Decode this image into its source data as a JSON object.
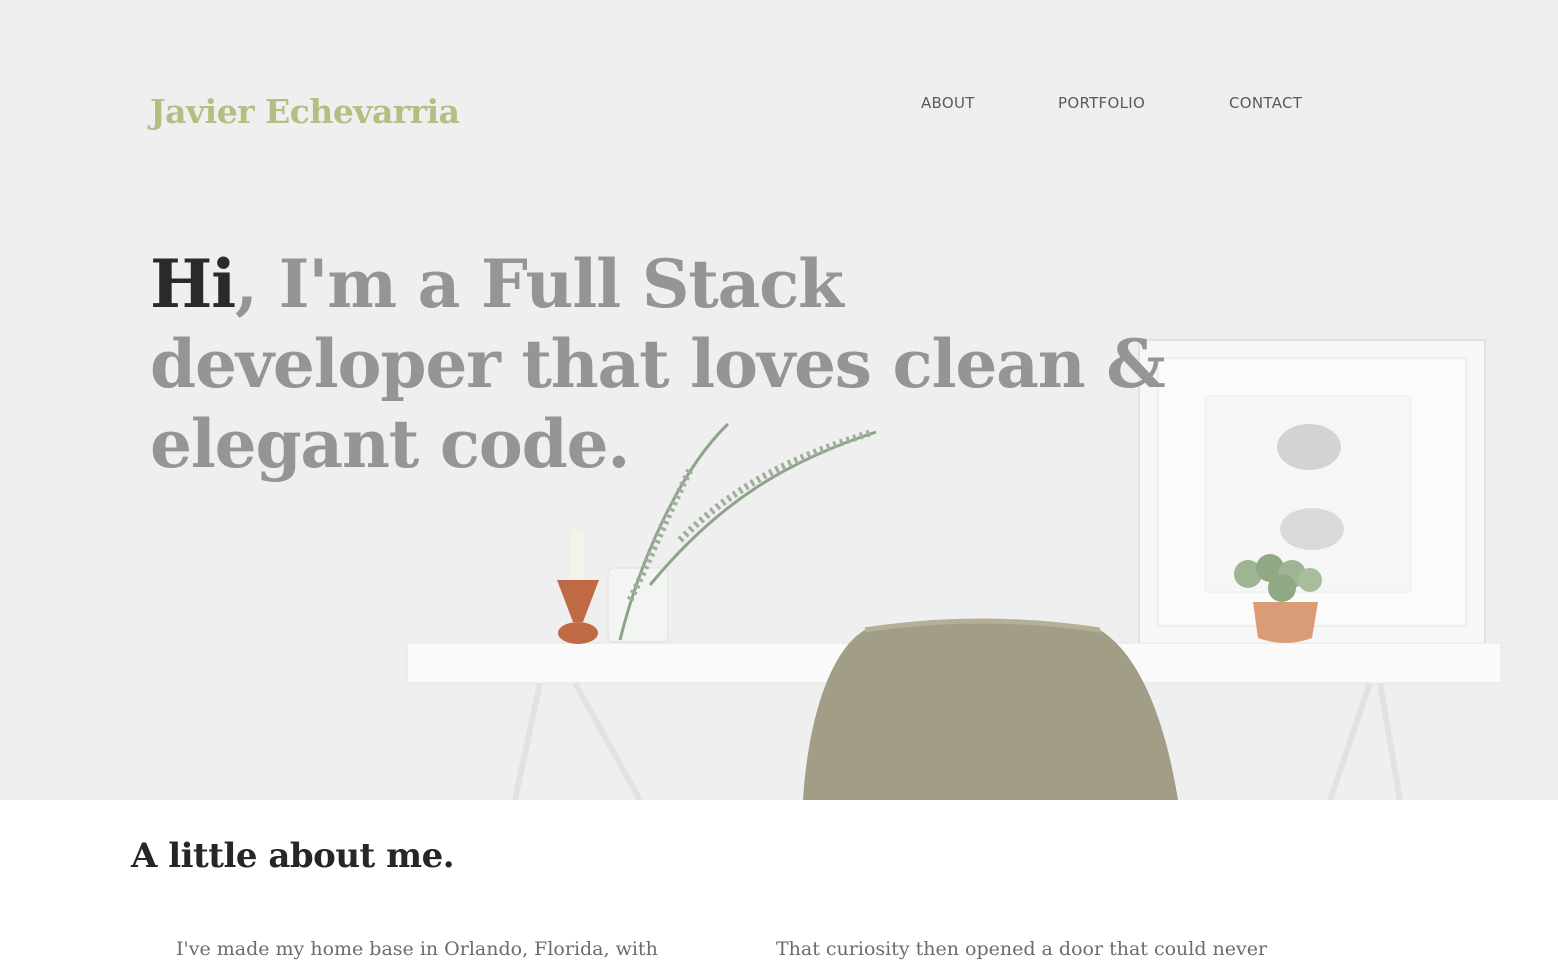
{
  "header": {
    "brand": "Javier Echevarria",
    "nav": [
      "ABOUT",
      "PORTFOLIO",
      "CONTACT"
    ]
  },
  "hero": {
    "greeting": "Hi",
    "headline_rest": ", I'm a Full Stack developer that loves clean & elegant code."
  },
  "about": {
    "title": "A little about me.",
    "col1": "I've made my home base in Orlando, Florida, with",
    "col2": "That curiosity then opened a door that could never"
  },
  "colors": {
    "brand": "#b7bd82",
    "headline": "#959595",
    "greeting": "#2a2a2a",
    "hero_bg": "#efefef"
  }
}
